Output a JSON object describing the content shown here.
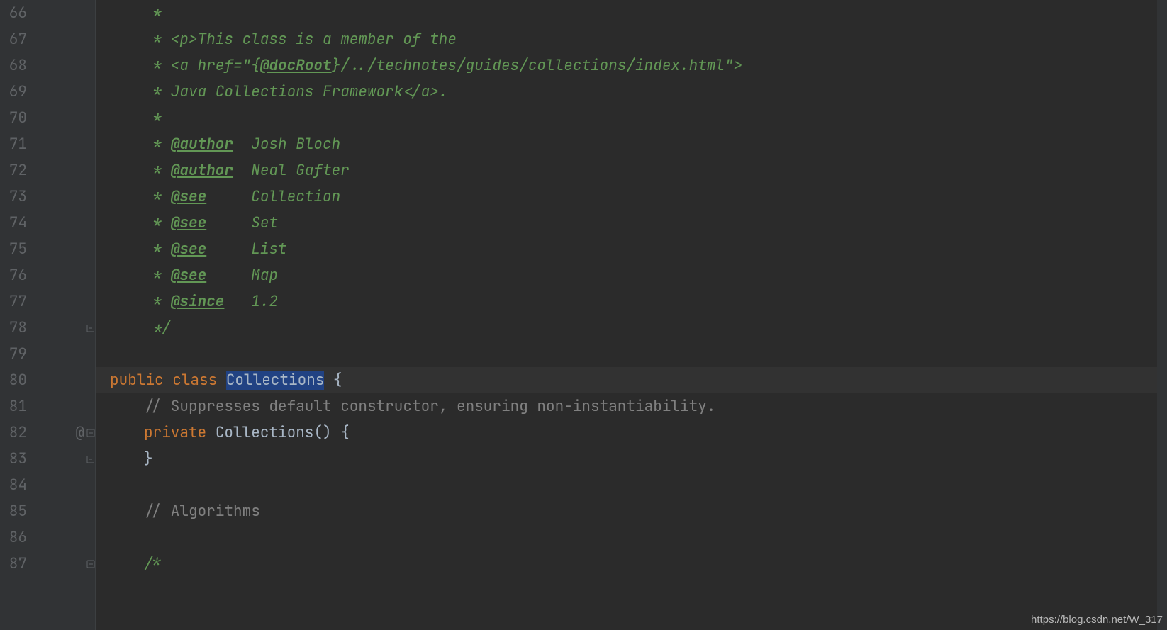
{
  "watermark": "https://blog.csdn.net/W_317",
  "highlighted_line": 80,
  "lines": [
    {
      "num": 66,
      "indent": 1,
      "tokens": [
        {
          "cls": "c-comment",
          "t": " *"
        }
      ]
    },
    {
      "num": 67,
      "indent": 1,
      "tokens": [
        {
          "cls": "c-comment",
          "t": " * <p>This class is a member of the"
        }
      ]
    },
    {
      "num": 68,
      "indent": 1,
      "tokens": [
        {
          "cls": "c-comment",
          "t": " * <a href=\"{"
        },
        {
          "cls": "c-tag",
          "t": "@docRoot"
        },
        {
          "cls": "c-comment",
          "t": "}/../technotes/guides/collections/index.html\">"
        }
      ]
    },
    {
      "num": 69,
      "indent": 1,
      "tokens": [
        {
          "cls": "c-comment",
          "t": " * Java Collections Framework</a>."
        }
      ]
    },
    {
      "num": 70,
      "indent": 1,
      "tokens": [
        {
          "cls": "c-comment",
          "t": " *"
        }
      ]
    },
    {
      "num": 71,
      "indent": 1,
      "tokens": [
        {
          "cls": "c-comment",
          "t": " * "
        },
        {
          "cls": "c-tag",
          "t": "@author"
        },
        {
          "cls": "c-comment",
          "t": "  Josh Bloch"
        }
      ]
    },
    {
      "num": 72,
      "indent": 1,
      "tokens": [
        {
          "cls": "c-comment",
          "t": " * "
        },
        {
          "cls": "c-tag",
          "t": "@author"
        },
        {
          "cls": "c-comment",
          "t": "  Neal Gafter"
        }
      ]
    },
    {
      "num": 73,
      "indent": 1,
      "tokens": [
        {
          "cls": "c-comment",
          "t": " * "
        },
        {
          "cls": "c-tag",
          "t": "@see"
        },
        {
          "cls": "c-comment",
          "t": "     Collection"
        }
      ]
    },
    {
      "num": 74,
      "indent": 1,
      "tokens": [
        {
          "cls": "c-comment",
          "t": " * "
        },
        {
          "cls": "c-tag",
          "t": "@see"
        },
        {
          "cls": "c-comment",
          "t": "     Set"
        }
      ]
    },
    {
      "num": 75,
      "indent": 1,
      "tokens": [
        {
          "cls": "c-comment",
          "t": " * "
        },
        {
          "cls": "c-tag",
          "t": "@see"
        },
        {
          "cls": "c-comment",
          "t": "     List"
        }
      ]
    },
    {
      "num": 76,
      "indent": 1,
      "tokens": [
        {
          "cls": "c-comment",
          "t": " * "
        },
        {
          "cls": "c-tag",
          "t": "@see"
        },
        {
          "cls": "c-comment",
          "t": "     Map"
        }
      ]
    },
    {
      "num": 77,
      "indent": 1,
      "tokens": [
        {
          "cls": "c-comment",
          "t": " * "
        },
        {
          "cls": "c-tag",
          "t": "@since"
        },
        {
          "cls": "c-comment",
          "t": "   1.2"
        }
      ]
    },
    {
      "num": 78,
      "indent": 1,
      "fold": "end",
      "tokens": [
        {
          "cls": "c-comment",
          "t": " */"
        }
      ]
    },
    {
      "num": 79,
      "indent": 0,
      "tokens": []
    },
    {
      "num": 80,
      "indent": 0,
      "tokens": [
        {
          "cls": "c-kw",
          "t": "public class "
        },
        {
          "cls": "sel",
          "t": "Collections"
        },
        {
          "cls": "c-plain",
          "t": " {"
        }
      ]
    },
    {
      "num": 81,
      "indent": 1,
      "tokens": [
        {
          "cls": "c-line-comment",
          "t": "// Suppresses default constructor, ensuring non-instantiability."
        }
      ]
    },
    {
      "num": 82,
      "indent": 1,
      "mark": "@",
      "fold": "start",
      "tokens": [
        {
          "cls": "c-kw",
          "t": "private "
        },
        {
          "cls": "c-plain",
          "t": "Collections"
        },
        {
          "cls": "c-plain",
          "t": "() {"
        }
      ]
    },
    {
      "num": 83,
      "indent": 1,
      "fold": "end",
      "tokens": [
        {
          "cls": "c-plain",
          "t": "}"
        }
      ]
    },
    {
      "num": 84,
      "indent": 0,
      "tokens": []
    },
    {
      "num": 85,
      "indent": 1,
      "tokens": [
        {
          "cls": "c-line-comment",
          "t": "// Algorithms"
        }
      ]
    },
    {
      "num": 86,
      "indent": 0,
      "tokens": []
    },
    {
      "num": 87,
      "indent": 1,
      "fold": "start",
      "tokens": [
        {
          "cls": "c-comment",
          "t": "/*"
        }
      ]
    }
  ]
}
